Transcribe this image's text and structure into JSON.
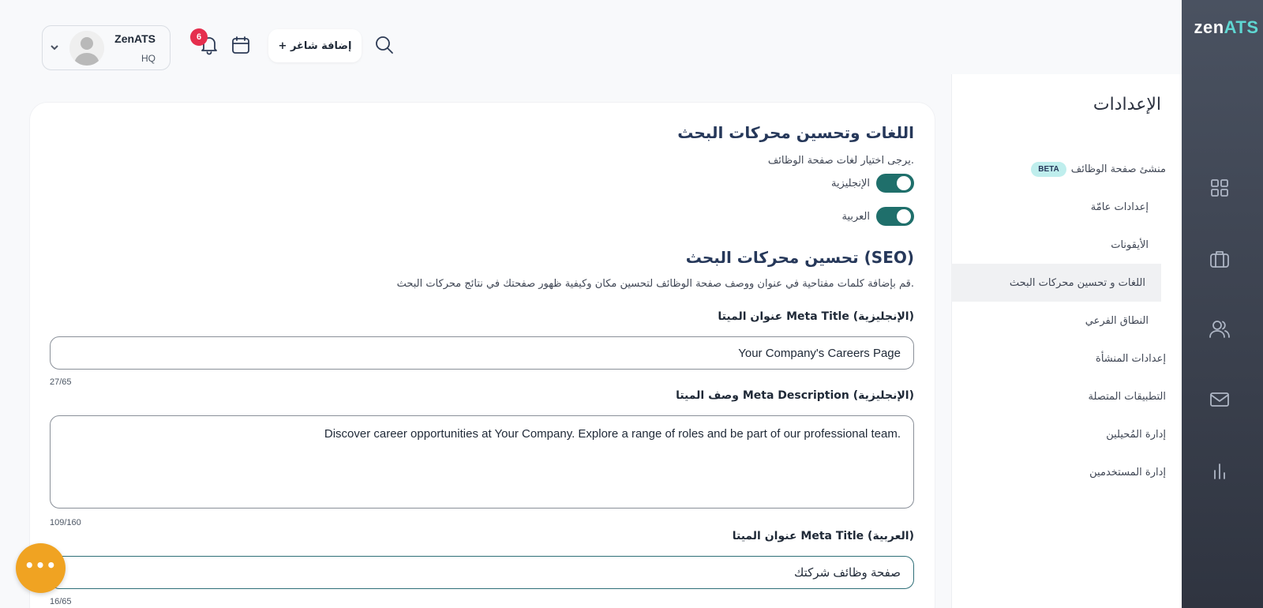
{
  "brand": {
    "logo_part1": "zen",
    "logo_part2": "ATS"
  },
  "rail": {
    "icons": [
      "grid-icon",
      "briefcase-icon",
      "users-icon",
      "mail-icon",
      "bar-chart-icon"
    ]
  },
  "settings": {
    "title": "الإعدادات",
    "beta_badge": "BETA",
    "items": [
      {
        "label": "منشئ صفحة الوظائف"
      },
      {
        "label": "إعدادات عامّة"
      },
      {
        "label": "الأيقونات"
      },
      {
        "label": "اللغات و تحسين محركات البحث",
        "active": true
      },
      {
        "label": "النطاق الفرعي"
      },
      {
        "label": "إعدادات المنشأة"
      },
      {
        "label": "التطبيقات المتصلة"
      },
      {
        "label": "إدارة المُحيلين"
      },
      {
        "label": "إدارة المستخدمين"
      }
    ]
  },
  "header": {
    "user_name": "ZenATS",
    "user_sub": "HQ",
    "notification_count": "6",
    "add_job_label": "+ إضافة شاغر"
  },
  "main": {
    "lang_title": "اللغات وتحسين محركات البحث",
    "lang_desc": "يرجى اختيار لغات صفحة الوظائف.",
    "toggles": [
      {
        "label": "الإنجليزية",
        "on": true
      },
      {
        "label": "العربية",
        "on": true
      }
    ],
    "seo_title": "تحسين محركات البحث (SEO)",
    "seo_desc": "قم بإضافة كلمات مفتاحية في عنوان ووصف صفحة الوظائف لتحسين مكان وكيفية ظهور صفحتك في نتائج محركات البحث.",
    "fields": [
      {
        "label": "عنوان الميتا Meta Title (الإنجليزية)",
        "value": "Your Company's Careers Page",
        "counter": "27/65"
      },
      {
        "label": "وصف الميتا Meta Description (الإنجليزية)",
        "value": "Discover career opportunities at Your Company. Explore a range of roles and be part of our professional team.",
        "counter": "109/160"
      },
      {
        "label": "عنوان الميتا Meta Title (العربية)",
        "value": "صفحة وظائف شركتك",
        "counter": "16/65"
      }
    ]
  },
  "fab": {
    "label": "•••"
  }
}
